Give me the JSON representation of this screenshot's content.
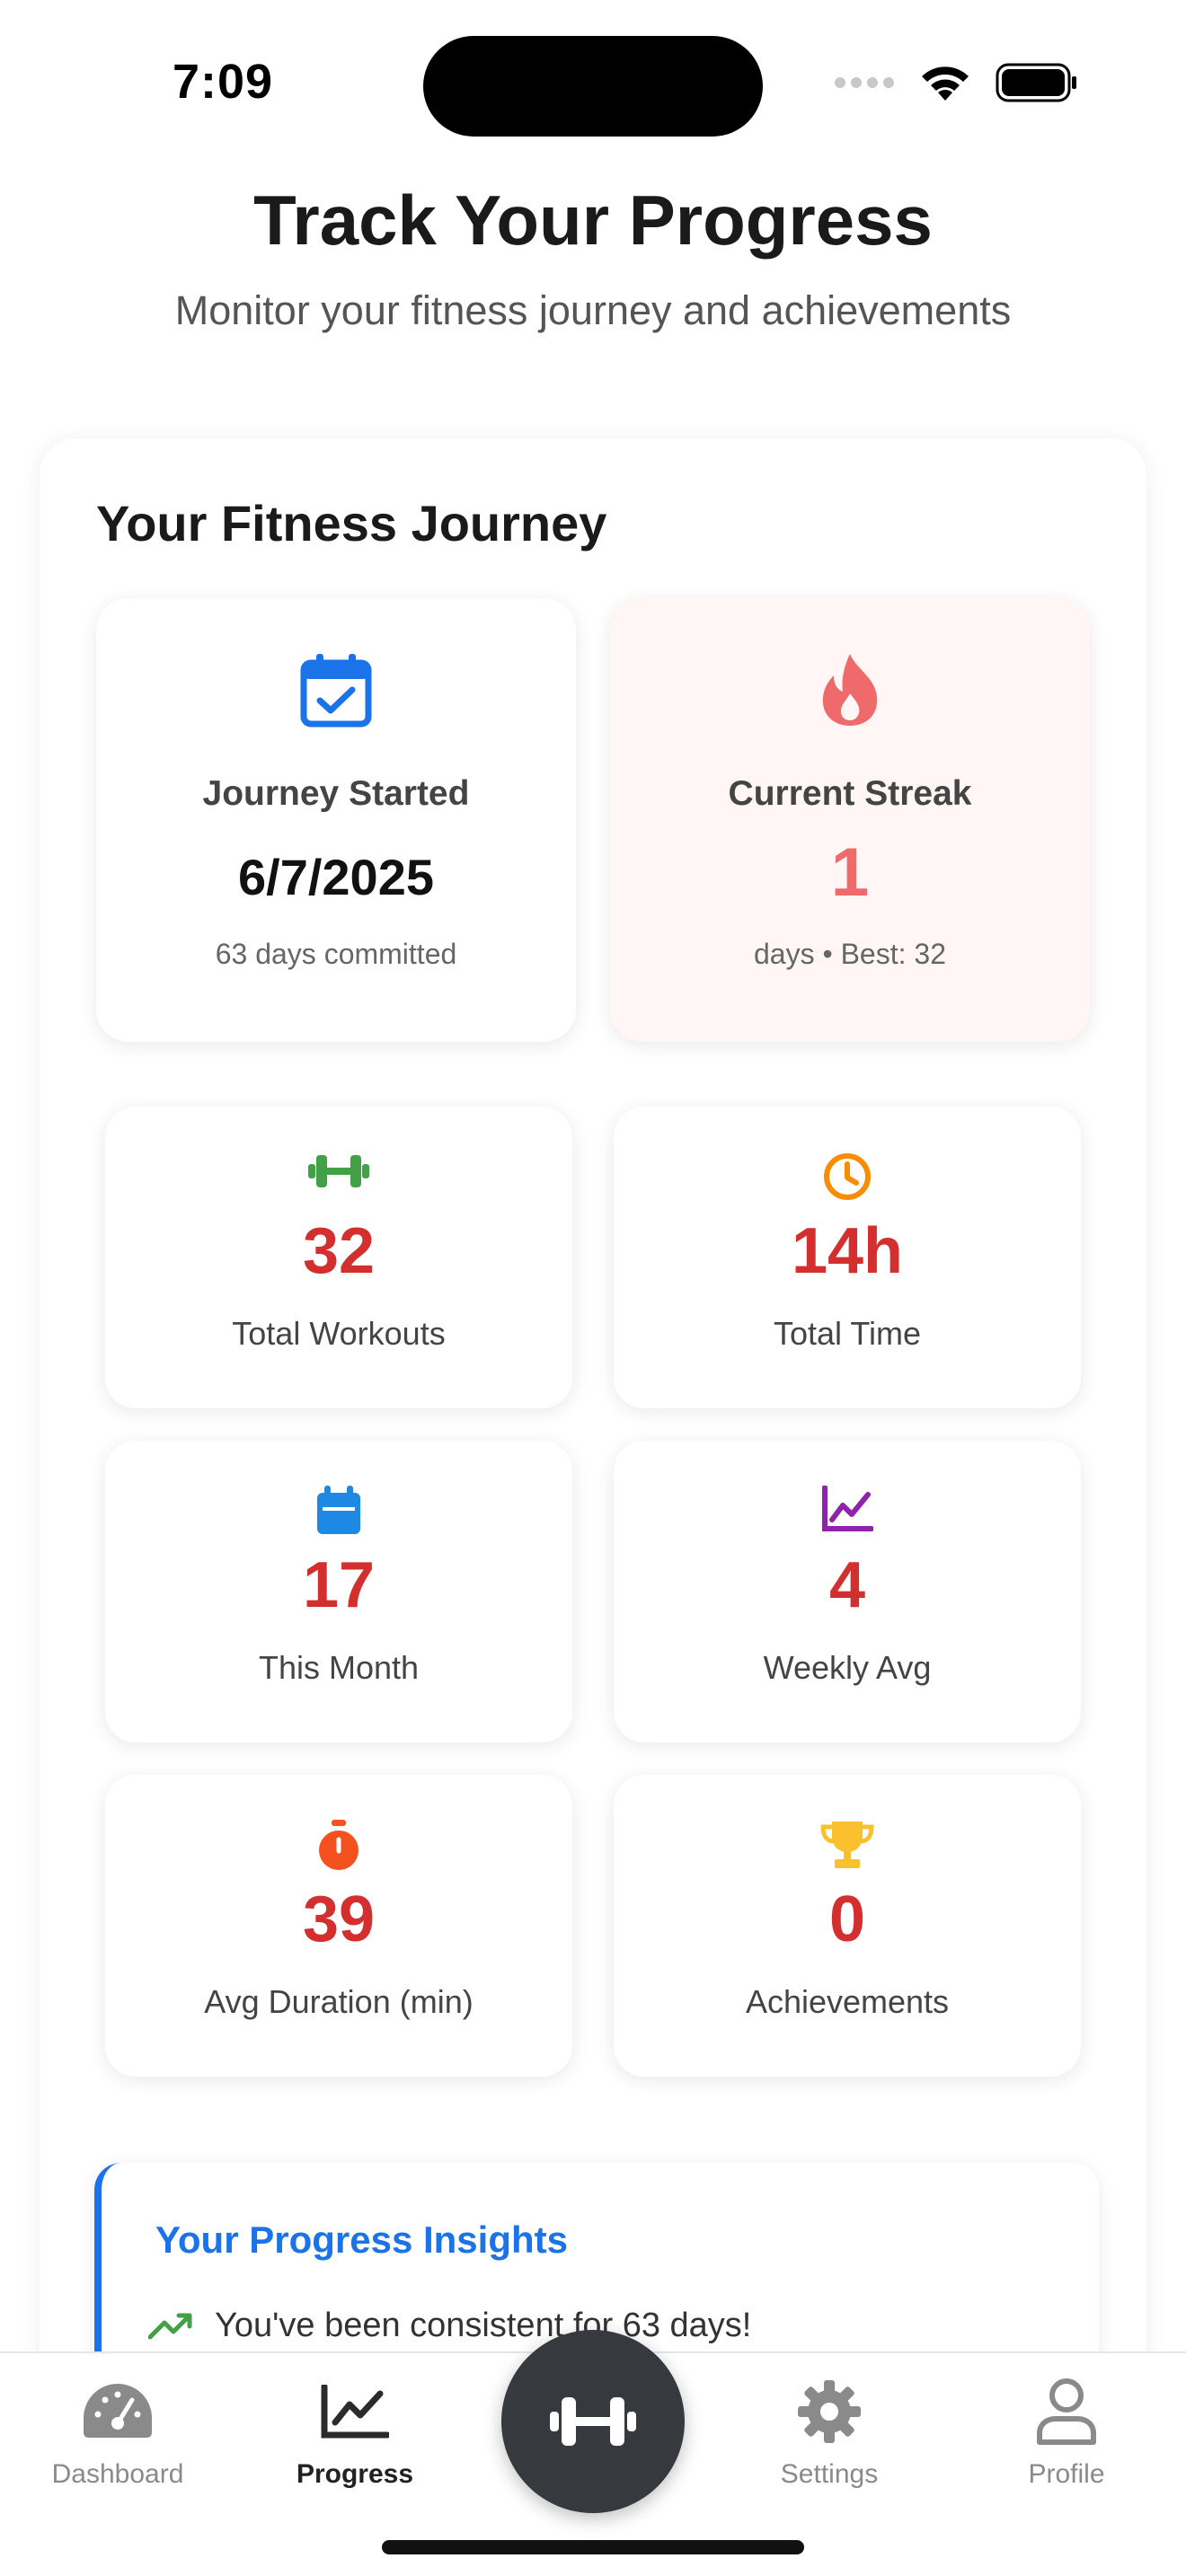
{
  "status_bar": {
    "time": "7:09"
  },
  "header": {
    "title": "Track Your Progress",
    "subtitle": "Monitor your fitness journey and achievements"
  },
  "journey": {
    "title": "Your Fitness Journey",
    "started": {
      "label": "Journey Started",
      "date": "6/7/2025",
      "sub": "63 days committed",
      "icon": "calendar-check-icon",
      "color": "#1a73e8"
    },
    "streak": {
      "label": "Current Streak",
      "value": "1",
      "sub": "days • Best: 32",
      "icon": "flame-icon",
      "color": "#ef6b6b"
    }
  },
  "stats": [
    {
      "value": "32",
      "label": "Total Workouts",
      "icon": "dumbbell-icon",
      "color": "#43a047"
    },
    {
      "value": "14h",
      "label": "Total Time",
      "icon": "clock-icon",
      "color": "#fb8c00"
    },
    {
      "value": "17",
      "label": "This Month",
      "icon": "calendar-icon",
      "color": "#1e88e5"
    },
    {
      "value": "4",
      "label": "Weekly Avg",
      "icon": "chart-line-icon",
      "color": "#8e24aa"
    },
    {
      "value": "39",
      "label": "Avg Duration (min)",
      "icon": "stopwatch-icon",
      "color": "#f4511e"
    },
    {
      "value": "0",
      "label": "Achievements",
      "icon": "trophy-icon",
      "color": "#fbc02d"
    }
  ],
  "insights": {
    "title": "Your Progress Insights",
    "items": [
      {
        "text": "You've been consistent for 63 days!",
        "icon": "trending-up-icon",
        "color": "#43a047"
      }
    ]
  },
  "tab_bar": {
    "items": [
      {
        "label": "Dashboard",
        "icon": "speedometer-icon",
        "active": false
      },
      {
        "label": "Progress",
        "icon": "chart-line-icon",
        "active": true
      },
      {
        "label": "Settings",
        "icon": "gear-icon",
        "active": false
      },
      {
        "label": "Profile",
        "icon": "person-icon",
        "active": false
      }
    ],
    "center_icon": "dumbbell-icon"
  }
}
